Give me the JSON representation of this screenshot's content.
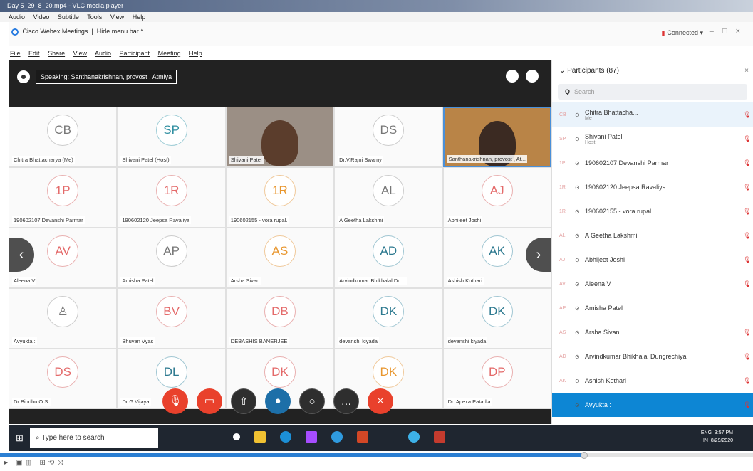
{
  "vlc": {
    "title": "Day 5_29_8_20.mp4 - VLC media player",
    "menu": [
      "Audio",
      "Video",
      "Subtitle",
      "Tools",
      "View",
      "Help"
    ]
  },
  "webex": {
    "app_name": "Cisco Webex Meetings",
    "hide_menu": "Hide menu bar ^",
    "status": "Connected",
    "menu": [
      "File",
      "Edit",
      "Share",
      "View",
      "Audio",
      "Participant",
      "Meeting",
      "Help"
    ]
  },
  "stage": {
    "speaking": "Speaking: Santhanakrishnan, provost , Atmiya",
    "tiles": [
      {
        "initials": "CB",
        "label": "Chitra Bhattacharya (Me)",
        "style": "c5"
      },
      {
        "initials": "SP",
        "label": "Shivani Patel (Host)",
        "style": "c2"
      },
      {
        "initials": "",
        "label": "Shivani Patel",
        "style": "video"
      },
      {
        "initials": "DS",
        "label": "Dr.V.Rajni Swamy",
        "style": "c5"
      },
      {
        "initials": "",
        "label": "Santhanakrishnan, provost , At...",
        "style": "video2"
      },
      {
        "initials": "1P",
        "label": "190602107 Devanshi Parmar",
        "style": "c1"
      },
      {
        "initials": "1R",
        "label": "190602120 Jeepsa Ravaliya",
        "style": "c1"
      },
      {
        "initials": "1R",
        "label": "190602155 - vora rupal.",
        "style": "c3"
      },
      {
        "initials": "AL",
        "label": "A Geetha Lakshmi",
        "style": "c5"
      },
      {
        "initials": "AJ",
        "label": "Abhijeet Joshi",
        "style": "c1"
      },
      {
        "initials": "AV",
        "label": "Aleena V",
        "style": "c1"
      },
      {
        "initials": "AP",
        "label": "Amisha Patel",
        "style": "c5"
      },
      {
        "initials": "AS",
        "label": "Arsha Sivan",
        "style": "c3"
      },
      {
        "initials": "AD",
        "label": "Arvindkumar Bhikhalal Du...",
        "style": "c4"
      },
      {
        "initials": "AK",
        "label": "Ashish Kothari",
        "style": "c4"
      },
      {
        "initials": "",
        "label": "Avyukta :",
        "style": "c5"
      },
      {
        "initials": "BV",
        "label": "Bhuvan Vyas",
        "style": "c1"
      },
      {
        "initials": "DB",
        "label": "DEBASHIS BANERJEE",
        "style": "c1"
      },
      {
        "initials": "DK",
        "label": "devanshi kiyada",
        "style": "c4"
      },
      {
        "initials": "DK",
        "label": "devanshi kiyada",
        "style": "c4"
      },
      {
        "initials": "DS",
        "label": "Dr Bindhu O.S.",
        "style": "c1"
      },
      {
        "initials": "DL",
        "label": "Dr G Vijaya",
        "style": "c4"
      },
      {
        "initials": "DK",
        "label": "",
        "style": "c1"
      },
      {
        "initials": "DK",
        "label": "",
        "style": "c3"
      },
      {
        "initials": "DP",
        "label": "Dr. Apexa Patadia",
        "style": "c1"
      }
    ]
  },
  "participants": {
    "title": "Participants (87)",
    "search_placeholder": "Search",
    "items": [
      {
        "initials": "CB",
        "name": "Chitra Bhattacha...",
        "sub": "Me"
      },
      {
        "initials": "SP",
        "name": "Shivani Patel",
        "sub": "Host"
      },
      {
        "initials": "1P",
        "name": "190602107 Devanshi Parmar",
        "sub": ""
      },
      {
        "initials": "1R",
        "name": "190602120 Jeepsa Ravaliya",
        "sub": ""
      },
      {
        "initials": "1R",
        "name": "190602155 - vora rupal.",
        "sub": ""
      },
      {
        "initials": "AL",
        "name": "A Geetha Lakshmi",
        "sub": ""
      },
      {
        "initials": "AJ",
        "name": "Abhijeet Joshi",
        "sub": ""
      },
      {
        "initials": "AV",
        "name": "Aleena V",
        "sub": ""
      },
      {
        "initials": "AP",
        "name": "Amisha Patel",
        "sub": ""
      },
      {
        "initials": "AS",
        "name": "Arsha Sivan",
        "sub": ""
      },
      {
        "initials": "AD",
        "name": "Arvindkumar Bhikhalal Dungrechiya",
        "sub": ""
      },
      {
        "initials": "AK",
        "name": "Ashish Kothari",
        "sub": ""
      },
      {
        "initials": "",
        "name": "Avyukta :",
        "sub": ""
      }
    ]
  },
  "taskbar": {
    "search_placeholder": "Type here to search",
    "lang1": "ENG",
    "lang2": "IN",
    "time": "3:57 PM",
    "date": "8/29/2020"
  },
  "colors": {
    "accent": "#0d86d4",
    "danger": "#e9412c",
    "seek": "#2b7fd3"
  }
}
